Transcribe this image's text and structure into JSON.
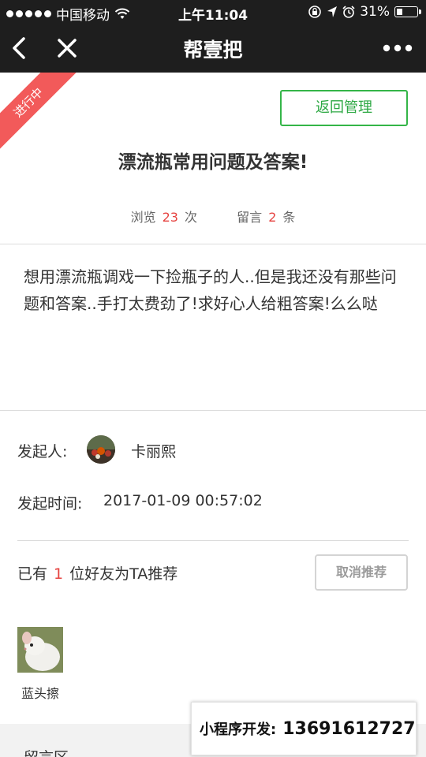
{
  "status_bar": {
    "carrier": "中国移动",
    "time": "上午11:04",
    "battery": "31%",
    "battery_level": 0.31,
    "icons": [
      "signal-dots-icon",
      "wifi-icon",
      "orientation-lock-icon",
      "location-icon",
      "alarm-icon",
      "battery-icon"
    ]
  },
  "nav": {
    "title": "帮壹把",
    "icons": [
      "back-icon",
      "close-icon",
      "more-icon"
    ]
  },
  "topic": {
    "status_ribbon": "进行中",
    "return_button": "返回管理",
    "title": "漂流瓶常用问题及答案!",
    "views_label": "浏览",
    "views_count": "23",
    "views_unit": "次",
    "comments_label": "留言",
    "comments_count": "2",
    "comments_unit": "条",
    "body": "想用漂流瓶调戏一下捡瓶子的人..但是我还没有那些问题和答案..手打太费劲了!求好心人给粗答案!么么哒"
  },
  "initiator": {
    "label": "发起人:",
    "name": "卡丽熙",
    "time_label": "发起时间:",
    "time": "2017-01-09 00:57:02"
  },
  "recommend": {
    "prefix": "已有",
    "count": "1",
    "suffix": "位好友为TA推荐",
    "cancel_button": "取消推荐",
    "friends": [
      {
        "name": "蓝头擦"
      }
    ]
  },
  "comments": {
    "label": "留言区"
  },
  "watermark": {
    "label": "小程序开发:",
    "number": "13691612727"
  },
  "colors": {
    "nav_bg": "#1e1e1e",
    "accent_green": "#2da843",
    "accent_red": "#e64340",
    "ribbon_red": "#f25a5a"
  }
}
